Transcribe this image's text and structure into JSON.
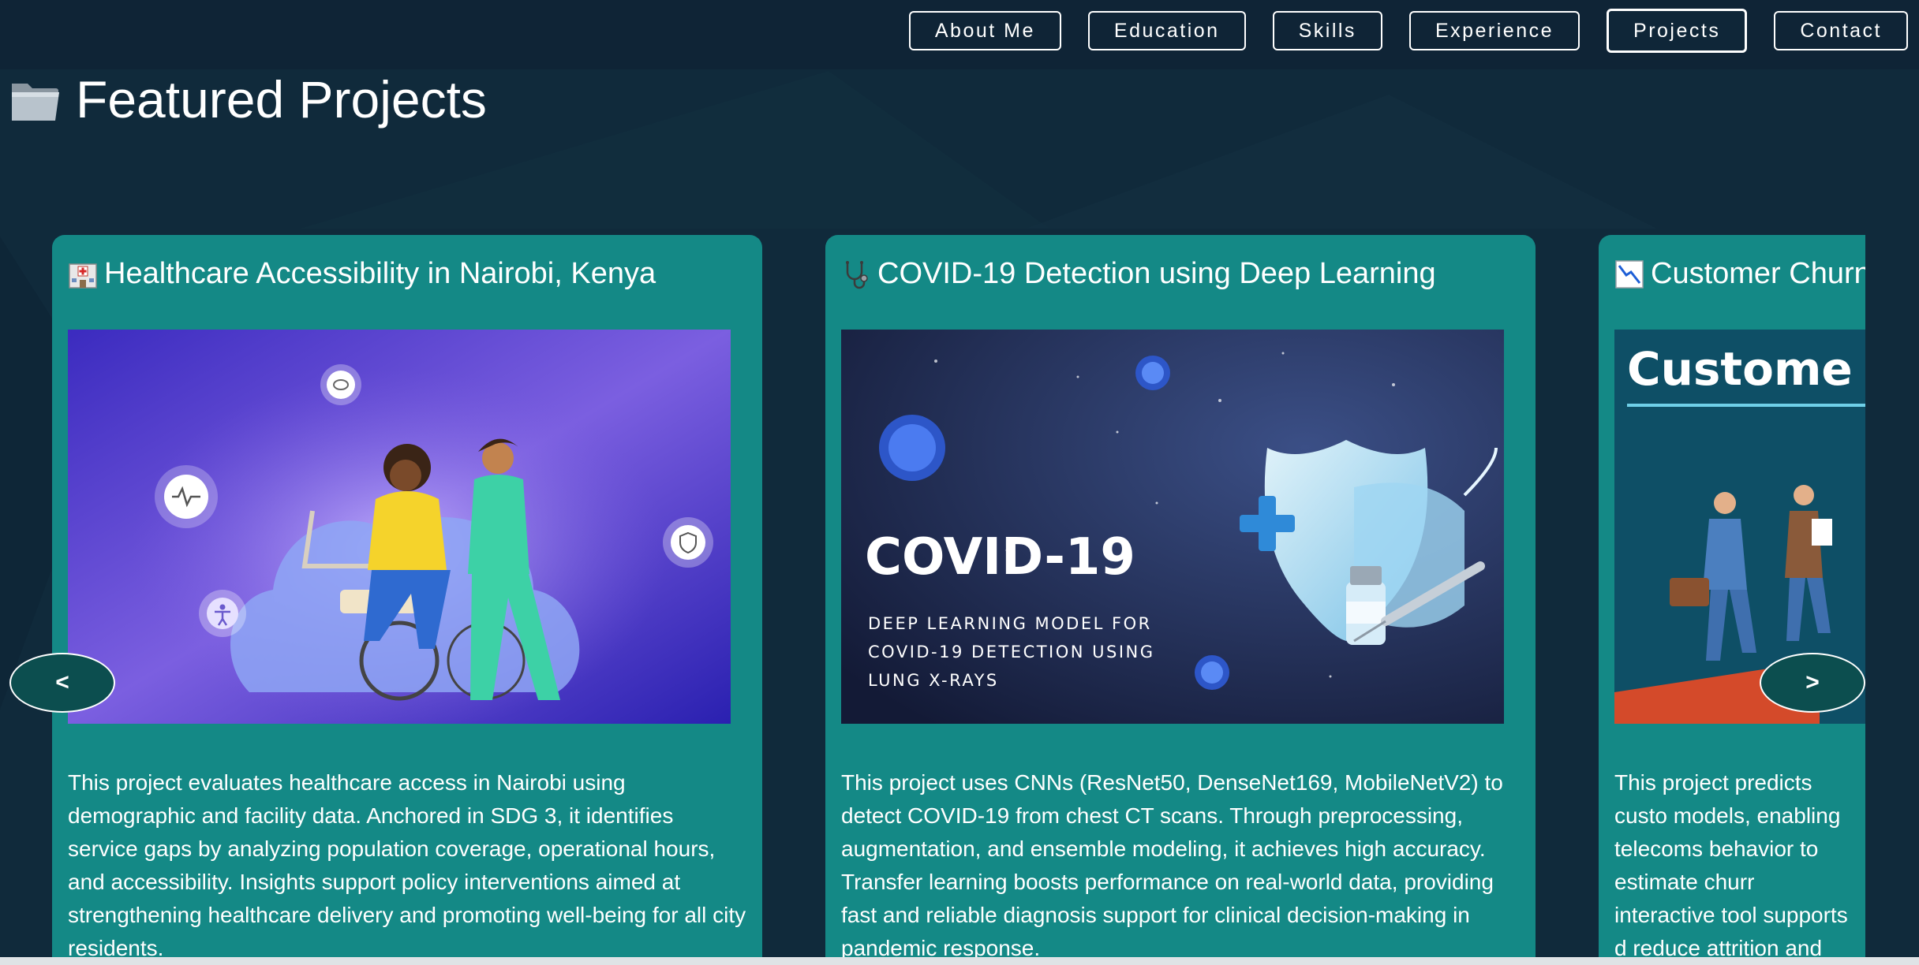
{
  "nav": {
    "items": [
      {
        "label": "About Me",
        "active": false
      },
      {
        "label": "Education",
        "active": false
      },
      {
        "label": "Skills",
        "active": false
      },
      {
        "label": "Experience",
        "active": false
      },
      {
        "label": "Projects",
        "active": true
      },
      {
        "label": "Contact",
        "active": false
      }
    ]
  },
  "section": {
    "title": "Featured Projects",
    "icon": "folder-icon"
  },
  "projects": [
    {
      "icon": "hospital-icon",
      "title": "Healthcare Accessibility in Nairobi, Kenya",
      "description": "This project evaluates healthcare access in Nairobi using demographic and facility data. Anchored in SDG 3, it identifies service gaps by analyzing population coverage, operational hours, and accessibility. Insights support policy interventions aimed at strengthening healthcare delivery and promoting well-being for all city residents."
    },
    {
      "icon": "stethoscope-icon",
      "title": "COVID-19 Detection using Deep Learning",
      "image_text": {
        "headline": "COVID-19",
        "line1": "DEEP LEARNING MODEL FOR",
        "line2": "COVID-19 DETECTION USING",
        "line3": "LUNG X-RAYS"
      },
      "description": "This project uses CNNs (ResNet50, DenseNet169, MobileNetV2) to detect COVID-19 from chest CT scans. Through preprocessing, augmentation, and ensemble modeling, it achieves high accuracy. Transfer learning boosts performance on real-world data, providing fast and reliable diagnosis support for clinical decision-making in pandemic response."
    },
    {
      "icon": "chart-decreasing-icon",
      "title": "Customer Churn",
      "image_text": {
        "headline": "Custome"
      },
      "description": "This project predicts custo models, enabling telecoms behavior to estimate churr interactive tool supports d reduce attrition and impro interventions."
    }
  ],
  "carousel": {
    "prev_label": "<",
    "next_label": ">"
  },
  "colors": {
    "background": "#102a3b",
    "card": "#148986",
    "carousel_button": "#0c4e4f"
  }
}
